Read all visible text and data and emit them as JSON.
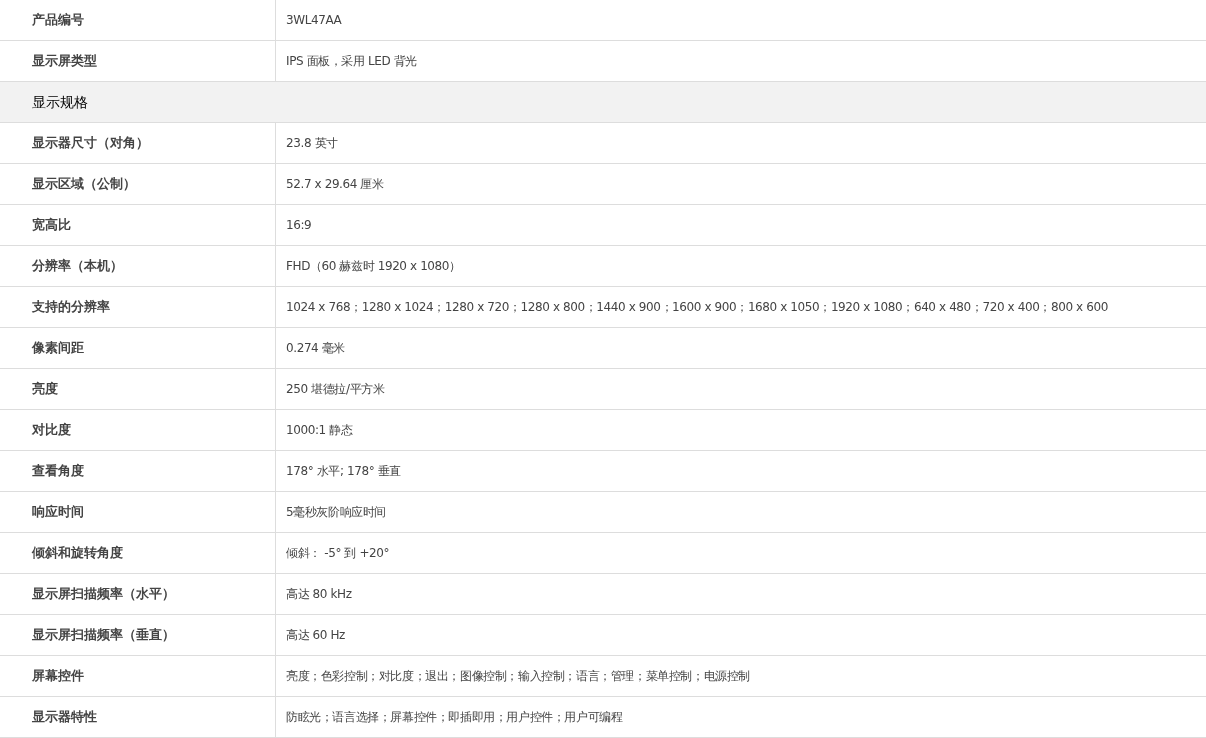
{
  "rows": [
    {
      "kind": "row",
      "label": "产品编号",
      "value": "3WL47AA"
    },
    {
      "kind": "row",
      "label": "显示屏类型",
      "value": "IPS 面板，采用 LED 背光"
    },
    {
      "kind": "section",
      "label": "显示规格"
    },
    {
      "kind": "row",
      "label": "显示器尺寸（对角）",
      "value": "23.8 英寸"
    },
    {
      "kind": "row",
      "label": "显示区域（公制）",
      "value": "52.7 x 29.64 厘米"
    },
    {
      "kind": "row",
      "label": "宽高比",
      "value": "16:9"
    },
    {
      "kind": "row",
      "label": "分辨率（本机）",
      "value": "FHD（60 赫兹时 1920 x 1080）"
    },
    {
      "kind": "row",
      "label": "支持的分辨率",
      "value": "1024 x 768；1280 x 1024；1280 x 720；1280 x 800；1440 x 900；1600 x 900；1680 x 1050；1920 x 1080；640 x 480；720 x 400；800 x 600"
    },
    {
      "kind": "row",
      "label": "像素间距",
      "value": "0.274 毫米"
    },
    {
      "kind": "row",
      "label": "亮度",
      "value": "250 堪德拉/平方米"
    },
    {
      "kind": "row",
      "label": "对比度",
      "value": "1000:1 静态"
    },
    {
      "kind": "row",
      "label": "查看角度",
      "value": "178° 水平; 178° 垂直"
    },
    {
      "kind": "row",
      "label": "响应时间",
      "value": "5毫秒灰阶响应时间"
    },
    {
      "kind": "row",
      "label": "倾斜和旋转角度",
      "value": "倾斜： -5° 到 +20°"
    },
    {
      "kind": "row",
      "label": "显示屏扫描频率（水平）",
      "value": "高达 80 kHz"
    },
    {
      "kind": "row",
      "label": "显示屏扫描频率（垂直）",
      "value": "高达 60 Hz"
    },
    {
      "kind": "row",
      "label": "屏幕控件",
      "value": "亮度；色彩控制；对比度；退出；图像控制；输入控制；语言；管理；菜单控制；电源控制"
    },
    {
      "kind": "row",
      "label": "显示器特性",
      "value": "防眩光；语言选择；屏幕控件；即插即用；用户控件；用户可编程"
    }
  ]
}
